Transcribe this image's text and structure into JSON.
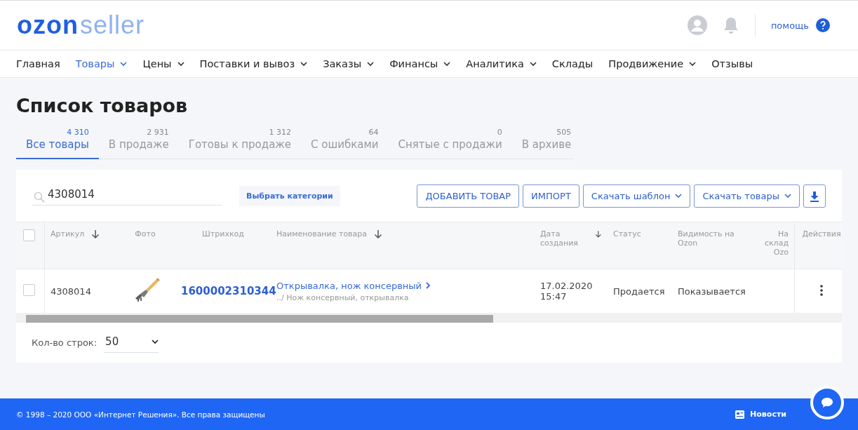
{
  "logo": {
    "brand": "ozon",
    "product": "seller"
  },
  "header": {
    "help": "помощь"
  },
  "nav": [
    {
      "label": "Главная",
      "selected": false,
      "dropdown": false
    },
    {
      "label": "Товары",
      "selected": true,
      "dropdown": true
    },
    {
      "label": "Цены",
      "selected": false,
      "dropdown": true
    },
    {
      "label": "Поставки и вывоз",
      "selected": false,
      "dropdown": true
    },
    {
      "label": "Заказы",
      "selected": false,
      "dropdown": true
    },
    {
      "label": "Финансы",
      "selected": false,
      "dropdown": true
    },
    {
      "label": "Аналитика",
      "selected": false,
      "dropdown": true
    },
    {
      "label": "Склады",
      "selected": false,
      "dropdown": false
    },
    {
      "label": "Продвижение",
      "selected": false,
      "dropdown": true
    },
    {
      "label": "Отзывы",
      "selected": false,
      "dropdown": false
    }
  ],
  "page_title": "Список товаров",
  "tabs": [
    {
      "count": "4 310",
      "label": "Все товары",
      "selected": true
    },
    {
      "count": "2 931",
      "label": "В продаже",
      "selected": false
    },
    {
      "count": "1 312",
      "label": "Готовы к продаже",
      "selected": false
    },
    {
      "count": "64",
      "label": "С ошибками",
      "selected": false
    },
    {
      "count": "0",
      "label": "Снятые с продажи",
      "selected": false
    },
    {
      "count": "505",
      "label": "В архиве",
      "selected": false
    }
  ],
  "search": {
    "value": "4308014"
  },
  "category_button": "Выбрать категории",
  "buttons": [
    {
      "label": "ДОБАВИТЬ ТОВАР",
      "dropdown": false
    },
    {
      "label": "ИМПОРТ",
      "dropdown": false
    },
    {
      "label": "Скачать шаблон",
      "dropdown": true
    },
    {
      "label": "Скачать товары",
      "dropdown": true
    }
  ],
  "table": {
    "all_checked": false,
    "columns": [
      {
        "label": "Артикул",
        "sortable": true
      },
      {
        "label": "Фото",
        "sortable": false
      },
      {
        "label": "Штрихкод",
        "sortable": false
      },
      {
        "label": "Наименование товара",
        "sortable": true
      },
      {
        "label": "Дата создания",
        "sortable": true
      },
      {
        "label": "Статус",
        "sortable": false
      },
      {
        "label": "Видимость на Ozon",
        "sortable": false
      },
      {
        "label": "На склад Ozo",
        "sortable": false
      },
      {
        "label": "Действия",
        "sortable": false
      }
    ],
    "rows": [
      {
        "checked": false,
        "article": "4308014",
        "barcode": "1600002310344",
        "name": "Открывалка, нож консервный",
        "category": "../ Нож консервный, открывалка",
        "date": "17.02.2020",
        "time": "15:47",
        "status": "Продается",
        "visibility": "Показывается"
      }
    ]
  },
  "rows_per_page": {
    "label": "Кол-во строк:",
    "value": "50"
  },
  "footer": {
    "copyright": "© 1998 – 2020 ООО «Интернет Решения». Все права защищены",
    "news": "Новости"
  }
}
